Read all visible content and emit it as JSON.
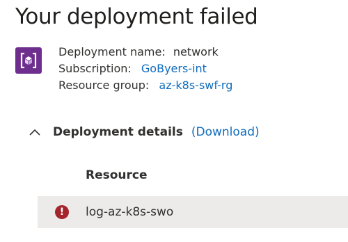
{
  "header": {
    "title": "Your deployment failed"
  },
  "deployment": {
    "icon": "deployment-cube-icon",
    "name_label": "Deployment name:",
    "name_value": "network",
    "subscription_label": "Subscription:",
    "subscription_value": "GoByers-int",
    "resource_group_label": "Resource group:",
    "resource_group_value": "az-k8s-swf-rg"
  },
  "details": {
    "chevron_icon": "chevron-up-icon",
    "title": "Deployment details",
    "download_label": "(Download)",
    "column_header": "Resource",
    "rows": [
      {
        "status_icon": "error-icon",
        "status_glyph": "!",
        "resource": "log-az-k8s-swo"
      }
    ]
  },
  "colors": {
    "accent_link": "#0f6cbd",
    "icon_bg": "#6d2e8e",
    "error": "#a4262c",
    "row_bg": "#edebe9"
  }
}
